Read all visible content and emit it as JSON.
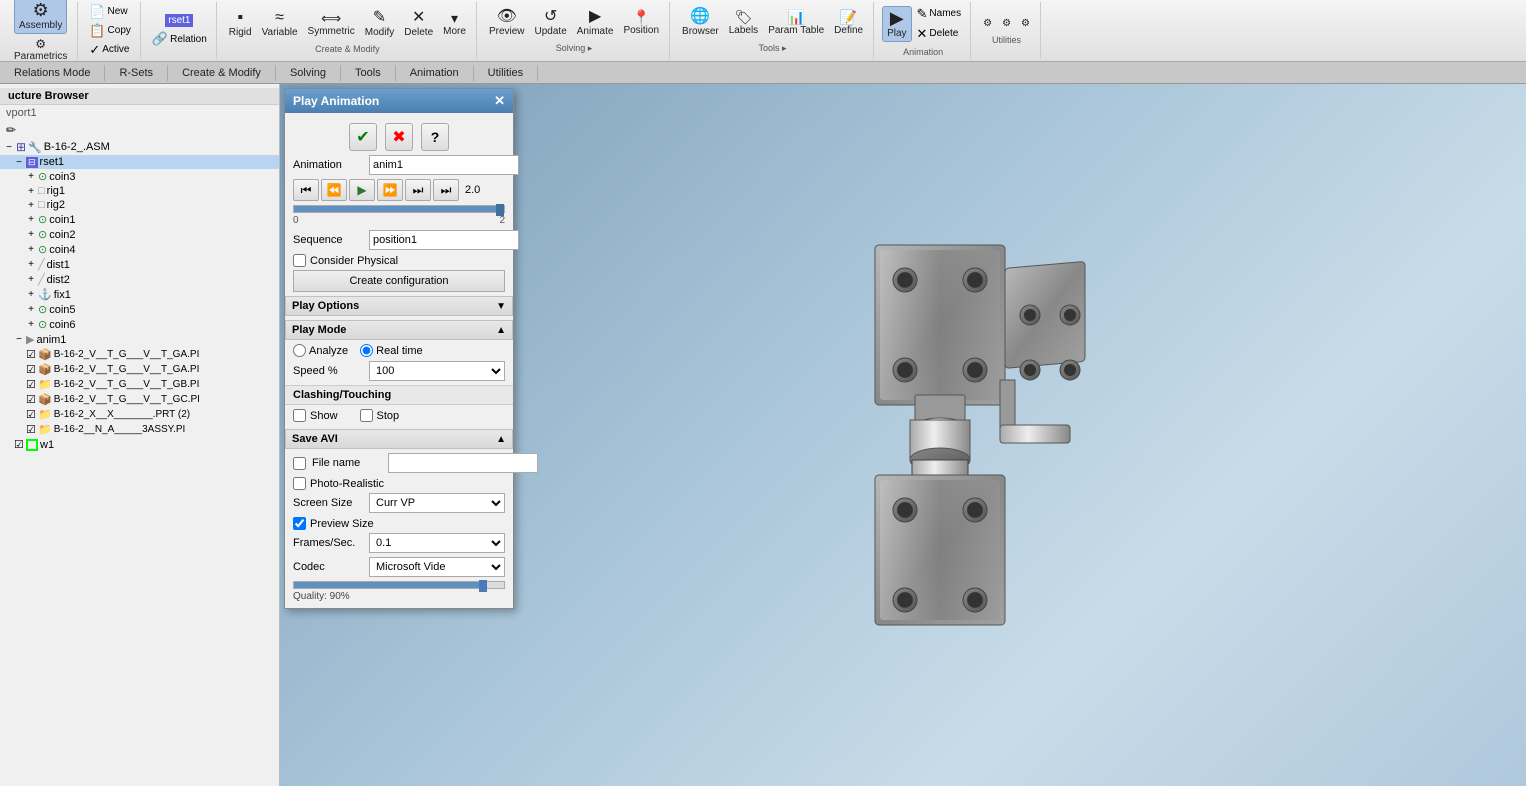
{
  "toolbar": {
    "groups": [
      {
        "name": "assembly",
        "label": "Assembly",
        "items": [
          {
            "id": "assembly-btn",
            "icon": "⚙",
            "label": "Assembly",
            "active": true
          }
        ]
      },
      {
        "name": "parametrics",
        "items": [
          {
            "id": "parametrics-btn",
            "icon": "⚙",
            "label": "Parametrics"
          }
        ]
      },
      {
        "name": "new-copy",
        "items": [
          {
            "id": "new-btn",
            "icon": "📄",
            "label": "New"
          },
          {
            "id": "copy-btn",
            "icon": "📋",
            "label": "Copy"
          },
          {
            "id": "active-btn",
            "icon": "✓",
            "label": "Active"
          }
        ]
      },
      {
        "name": "relation",
        "items": [
          {
            "id": "rset1-label",
            "icon": "",
            "label": "rset1"
          },
          {
            "id": "relation-btn",
            "icon": "🔗",
            "label": "Relation"
          }
        ]
      },
      {
        "name": "create-modify",
        "items": [
          {
            "id": "rigid-btn",
            "icon": "▪",
            "label": "Rigid"
          },
          {
            "id": "variable-btn",
            "icon": "≈",
            "label": "Variable"
          },
          {
            "id": "symmetric-btn",
            "icon": "⟺",
            "label": "Symmetric"
          },
          {
            "id": "modify-btn",
            "icon": "✎",
            "label": "Modify"
          },
          {
            "id": "delete-btn",
            "icon": "✕",
            "label": "Delete"
          },
          {
            "id": "more-btn",
            "icon": "▾",
            "label": "More"
          }
        ]
      },
      {
        "name": "solving",
        "items": [
          {
            "id": "preview-btn",
            "icon": "👁",
            "label": "Preview"
          },
          {
            "id": "update-btn",
            "icon": "↺",
            "label": "Update"
          },
          {
            "id": "animate-btn",
            "icon": "▶",
            "label": "Animate"
          },
          {
            "id": "position-btn",
            "icon": "📍",
            "label": "Position"
          }
        ]
      },
      {
        "name": "tools",
        "items": [
          {
            "id": "browser-btn",
            "icon": "🌐",
            "label": "Browser"
          },
          {
            "id": "labels-btn",
            "icon": "🏷",
            "label": "Labels"
          },
          {
            "id": "param-table-btn",
            "icon": "📊",
            "label": "Param Table"
          },
          {
            "id": "define-btn",
            "icon": "📝",
            "label": "Define"
          }
        ]
      },
      {
        "name": "animation",
        "items": [
          {
            "id": "play-btn",
            "icon": "▶",
            "label": "Play",
            "active": true
          },
          {
            "id": "names-btn",
            "icon": "✎",
            "label": "Names"
          },
          {
            "id": "delete2-btn",
            "icon": "✕",
            "label": "Delete"
          }
        ]
      },
      {
        "name": "utilities",
        "items": [
          {
            "id": "utilities-btn1",
            "icon": "⚙",
            "label": ""
          },
          {
            "id": "utilities-btn2",
            "icon": "⚙",
            "label": ""
          },
          {
            "id": "utilities-btn3",
            "icon": "⚙",
            "label": ""
          }
        ]
      }
    ]
  },
  "tabbar": {
    "tabs": [
      {
        "id": "tab-relations-mode",
        "label": "Relations Mode"
      },
      {
        "id": "tab-r-sets",
        "label": "R-Sets"
      },
      {
        "id": "tab-create-modify",
        "label": "Create & Modify"
      },
      {
        "id": "tab-solving",
        "label": "Solving"
      },
      {
        "id": "tab-tools",
        "label": "Tools"
      },
      {
        "id": "tab-animation",
        "label": "Animation"
      },
      {
        "id": "tab-utilities",
        "label": "Utilities"
      }
    ]
  },
  "left_panel": {
    "title": "ucture Browser",
    "viewport": "vport1",
    "tree": [
      {
        "id": "b162-asm",
        "label": "B-16-2_.ASM",
        "level": 1,
        "toggle": "−",
        "icon": "🔧"
      },
      {
        "id": "rset1",
        "label": "rset1",
        "level": 2,
        "toggle": "−",
        "icon": "⊟",
        "selected": true
      },
      {
        "id": "coin3",
        "label": "coin3",
        "level": 3,
        "toggle": "+",
        "icon": "⊙"
      },
      {
        "id": "rig1",
        "label": "rig1",
        "level": 3,
        "toggle": "+",
        "icon": "□"
      },
      {
        "id": "rig2",
        "label": "rig2",
        "level": 3,
        "toggle": "+",
        "icon": "□"
      },
      {
        "id": "coin1",
        "label": "coin1",
        "level": 3,
        "toggle": "+",
        "icon": "⊙"
      },
      {
        "id": "coin2",
        "label": "coin2",
        "level": 3,
        "toggle": "+",
        "icon": "⊙"
      },
      {
        "id": "coin4",
        "label": "coin4",
        "level": 3,
        "toggle": "+",
        "icon": "⊙"
      },
      {
        "id": "dist1",
        "label": "dist1",
        "level": 3,
        "toggle": "+",
        "icon": "╱"
      },
      {
        "id": "dist2",
        "label": "dist2",
        "level": 3,
        "toggle": "+",
        "icon": "╱"
      },
      {
        "id": "fix1",
        "label": "fix1",
        "level": 3,
        "toggle": "+",
        "icon": "⚓"
      },
      {
        "id": "coin5",
        "label": "coin5",
        "level": 3,
        "toggle": "+",
        "icon": "⊙"
      },
      {
        "id": "coin6",
        "label": "coin6",
        "level": 3,
        "toggle": "+",
        "icon": "⊙"
      },
      {
        "id": "anim1",
        "label": "anim1",
        "level": 2,
        "toggle": "−",
        "icon": "▶"
      },
      {
        "id": "part1",
        "label": "B-16-2_V__T_G___V__T_GA.PI",
        "level": 3,
        "toggle": "−",
        "icon": "📦"
      },
      {
        "id": "part2",
        "label": "B-16-2_V__T_G___V__T_GA.PI",
        "level": 3,
        "toggle": "−",
        "icon": "📦"
      },
      {
        "id": "part3",
        "label": "B-16-2_V__T_G___V__T_GB.PI",
        "level": 3,
        "toggle": "−",
        "icon": "📦"
      },
      {
        "id": "part4",
        "label": "B-16-2_V__T_G___V__T_GC.PI",
        "level": 3,
        "toggle": "−",
        "icon": "📦"
      },
      {
        "id": "part5",
        "label": "B-16-2_X__X_______.PRT (2)",
        "level": 3,
        "toggle": "−",
        "icon": "📁"
      },
      {
        "id": "part6",
        "label": "B-16-2__N_A_____3ASSY.PI",
        "level": 3,
        "toggle": "−",
        "icon": "📁"
      },
      {
        "id": "w1",
        "label": "w1",
        "level": 2,
        "toggle": "",
        "icon": "□",
        "color": "lime"
      }
    ]
  },
  "dialog": {
    "title": "Play Animation",
    "animation_label": "Animation",
    "animation_value": "anim1",
    "current_time": "2.0",
    "time_min": "0",
    "time_max": "2",
    "slider_pct": 100,
    "sequence_label": "Sequence",
    "sequence_value": "position1",
    "consider_physical_label": "Consider Physical",
    "consider_physical_checked": false,
    "create_config_label": "Create configuration",
    "play_options_label": "Play Options",
    "play_mode_label": "Play Mode",
    "analyze_label": "Analyze",
    "real_time_label": "Real time",
    "real_time_selected": true,
    "speed_label": "Speed %",
    "speed_value": "100",
    "clashing_label": "Clashing/Touching",
    "show_label": "Show",
    "show_checked": false,
    "stop_label": "Stop",
    "stop_checked": false,
    "save_avi_label": "Save AVI",
    "file_name_label": "File name",
    "file_name_checked": false,
    "file_name_value": "",
    "photo_realistic_label": "Photo-Realistic",
    "photo_realistic_checked": false,
    "screen_label": "Screen",
    "screen_size_label": "Screen Size",
    "screen_size_value": "Curr VP",
    "preview_size_label": "Preview Size",
    "preview_size_checked": true,
    "frames_sec_label": "Frames/Sec.",
    "frames_sec_value": "0.1",
    "codec_label": "Codec",
    "codec_value": "Microsoft Vide",
    "quality_label": "Quality: 90%",
    "quality_pct": 90
  },
  "icons": {
    "close": "✕",
    "check": "✔",
    "x_red": "✖",
    "question": "?",
    "skip_start": "⏮",
    "step_back": "⏪",
    "play": "▶",
    "step_fwd": "⏩",
    "skip_fwd": "⏭",
    "skip_end": "⏭",
    "collapse": "▲",
    "expand": "▼"
  }
}
